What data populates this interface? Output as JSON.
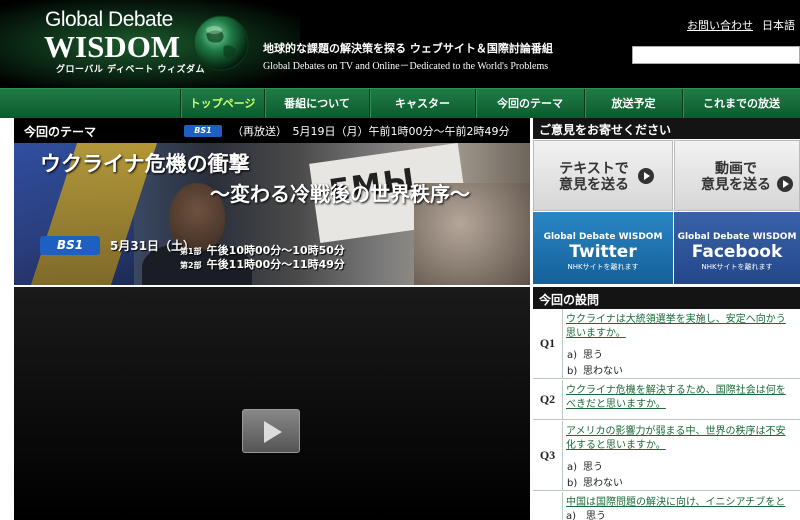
{
  "header": {
    "logo_top": "Global Debate",
    "logo_main": "WISDOM",
    "logo_sub": "グローバル ディベート ウィズダム",
    "tagline_jp": "地球的な課題の解決策を探る ウェブサイト＆国際討論番組",
    "tagline_en": "Global Debates on TV and Online－Dedicated to the World's Problems",
    "contact_label": "お問い合わせ",
    "language_label": "日本語",
    "search_value": ""
  },
  "nav": {
    "items": [
      {
        "label": "トップページ",
        "active": true
      },
      {
        "label": "番組について",
        "active": false
      },
      {
        "label": "キャスター",
        "active": false
      },
      {
        "label": "今回のテーマ",
        "active": false
      },
      {
        "label": "放送予定",
        "active": false
      },
      {
        "label": "これまでの放送",
        "active": false
      }
    ]
  },
  "theme": {
    "section_label": "今回のテーマ",
    "channel_small": "BS1",
    "rebroadcast": "（再放送）　5月19日（月）午前1時00分～午前2時49分",
    "title_line1": "ウクライナ危機の衝撃",
    "title_line2": "～変わる冷戦後の世界秩序～",
    "image_sign_text": "ЕМЫ",
    "channel_big": "BS1",
    "air_date": "5月31日（土）",
    "parts": [
      {
        "label": "第1部",
        "time": "午後10時00分～10時50分"
      },
      {
        "label": "第2部",
        "time": "午後11時00分～11時49分"
      }
    ]
  },
  "opinion": {
    "heading": "ご意見をお寄せください",
    "text_button": {
      "line1": "テキストで",
      "line2": "意見を送る"
    },
    "video_button": {
      "line1": "動画で",
      "line2": "意見を送る"
    },
    "twitter": {
      "top": "Global Debate WISDOM",
      "name": "Twitter",
      "sub": "NHKサイトを離れます",
      "color": "#1a6fa8"
    },
    "facebook": {
      "top": "Global Debate WISDOM",
      "name": "Facebook",
      "sub": "NHKサイトを離れます",
      "color": "#2a4f8f"
    }
  },
  "questions": {
    "heading": "今回の設問",
    "items": [
      {
        "num": "Q1",
        "lines": [
          "ウクライナは大統領選挙を実施し、安定へ向かう",
          "思いますか。"
        ],
        "options": [
          {
            "key": "a)",
            "text": "思う"
          },
          {
            "key": "b)",
            "text": "思わない"
          }
        ]
      },
      {
        "num": "Q2",
        "lines": [
          "ウクライナ危機を解決するため、国際社会は何を",
          "べきだと思いますか。"
        ],
        "options": []
      },
      {
        "num": "Q3",
        "lines": [
          "アメリカの影響力が弱まる中、世界の秩序は不安",
          "化すると思いますか。"
        ],
        "options": [
          {
            "key": "a)",
            "text": "思う"
          },
          {
            "key": "b)",
            "text": "思わない"
          }
        ]
      },
      {
        "num": "",
        "lines": [
          "中国は国際問題の解決に向け、イニシアチブをと",
          "a)　思う"
        ],
        "options": []
      }
    ]
  }
}
